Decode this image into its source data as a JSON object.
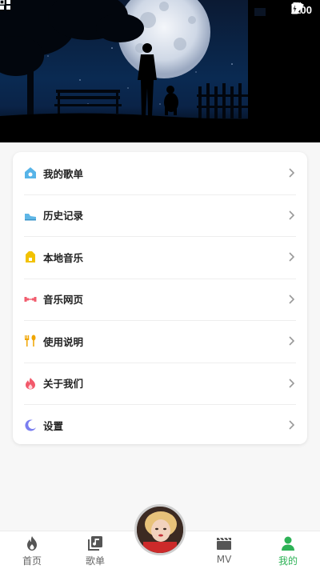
{
  "status": {
    "time": "9:00"
  },
  "menu": [
    {
      "label": "我的歌单",
      "icon": "playlist-home-icon",
      "color": "#57b4e8"
    },
    {
      "label": "历史记录",
      "icon": "sneaker-icon",
      "color": "#5fb6e6"
    },
    {
      "label": "本地音乐",
      "icon": "local-folder-icon",
      "color": "#f2c200"
    },
    {
      "label": "音乐网页",
      "icon": "dumbbell-icon",
      "color": "#f25c6e"
    },
    {
      "label": "使用说明",
      "icon": "fork-spoon-icon",
      "color": "#f0a500"
    },
    {
      "label": "关于我们",
      "icon": "flame-icon",
      "color": "#f2596b"
    },
    {
      "label": "设置",
      "icon": "moon-icon",
      "color": "#7a7ef0"
    }
  ],
  "nav": [
    {
      "label": "首页",
      "icon": "flame-outline-icon"
    },
    {
      "label": "歌单",
      "icon": "music-list-icon"
    },
    {
      "label": "MV",
      "icon": "clapperboard-icon"
    },
    {
      "label": "我的",
      "icon": "user-icon",
      "active": true
    }
  ],
  "colors": {
    "accent": "#2db256"
  }
}
